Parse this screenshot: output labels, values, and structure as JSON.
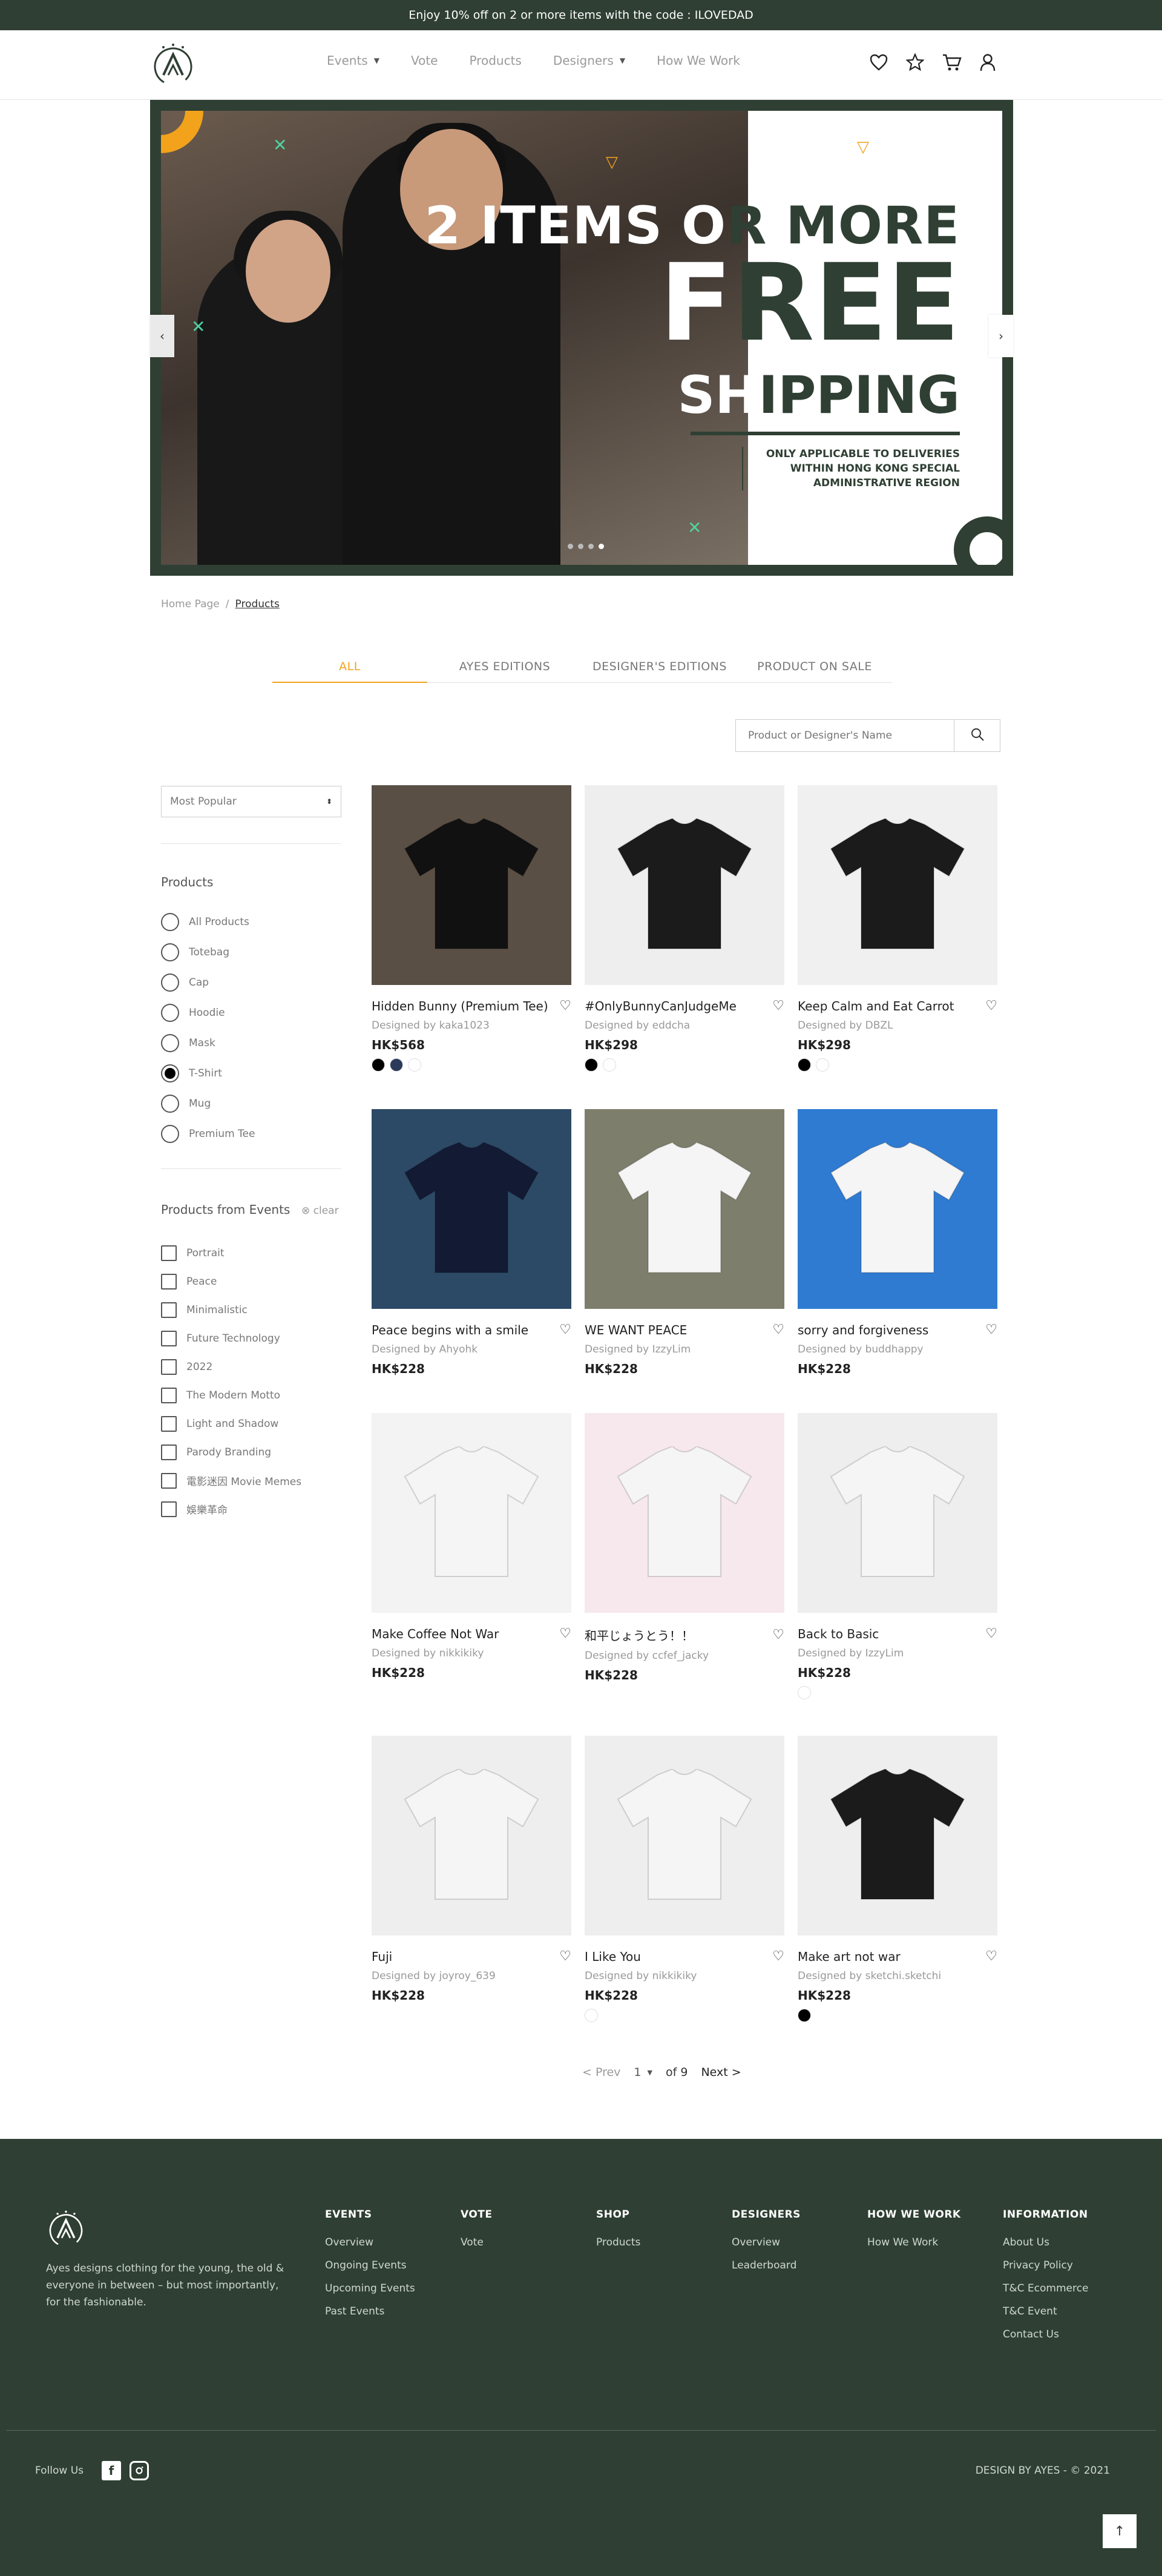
{
  "promo": {
    "text": "Enjoy 10% off on 2 or more items with the code : ILOVEDAD"
  },
  "nav": {
    "items": [
      {
        "label": "Events",
        "dropdown": true
      },
      {
        "label": "Vote",
        "dropdown": false
      },
      {
        "label": "Products",
        "dropdown": false
      },
      {
        "label": "Designers",
        "dropdown": true
      },
      {
        "label": "How We Work",
        "dropdown": false
      }
    ],
    "icons": [
      "heart-icon",
      "star-icon",
      "cart-icon",
      "user-icon"
    ]
  },
  "hero": {
    "line1": "2 ITEMS OR MORE",
    "line2": "FREE",
    "line3": "SHIPPING",
    "note": "ONLY APPLICABLE TO DELIVERIES WITHIN HONG KONG SPECIAL ADMINISTRATIVE REGION",
    "slides": 4,
    "active_slide": 4
  },
  "breadcrumb": {
    "home": "Home Page",
    "separator": "/",
    "current": "Products"
  },
  "tabs": [
    "ALL",
    "AYES EDITIONS",
    "DESIGNER'S EDITIONS",
    "PRODUCT ON SALE"
  ],
  "active_tab": "ALL",
  "search": {
    "placeholder": "Product or Designer's Name"
  },
  "sidebar": {
    "sort": "Most Popular",
    "products_title": "Products",
    "products": [
      "All Products",
      "Totebag",
      "Cap",
      "Hoodie",
      "Mask",
      "T-Shirt",
      "Mug",
      "Premium Tee"
    ],
    "selected_product": "T-Shirt",
    "events_title": "Products from Events",
    "clear_label": "⊗ clear",
    "events": [
      "Portrait",
      "Peace",
      "Minimalistic",
      "Future Technology",
      "2022",
      "The Modern Motto",
      "Light and Shadow",
      "Parody Branding",
      "電影迷因 Movie Memes",
      "娛樂革命"
    ]
  },
  "products": [
    {
      "name": "Hidden Bunny (Premium Tee)",
      "designer": "Designed by kaka1023",
      "price": "HK$568",
      "swatches": [
        "#000000",
        "#2b3a5a",
        "#ffffff"
      ],
      "shirt": "#111111"
    },
    {
      "name": "#OnlyBunnyCanJudgeMe",
      "designer": "Designed by eddcha",
      "price": "HK$298",
      "swatches": [
        "#000000",
        "#ffffff"
      ],
      "shirt": "#1b1b1b"
    },
    {
      "name": "Keep Calm and Eat Carrot",
      "designer": "Designed by DBZL",
      "price": "HK$298",
      "swatches": [
        "#000000",
        "#ffffff"
      ],
      "shirt": "#1b1b1b"
    },
    {
      "name": "Peace begins with a smile",
      "designer": "Designed by Ahyohk",
      "price": "HK$228",
      "swatches": [],
      "shirt": "#131a33"
    },
    {
      "name": "WE WANT PEACE",
      "designer": "Designed by IzzyLim",
      "price": "HK$228",
      "swatches": [],
      "shirt": "#f5f5f5"
    },
    {
      "name": "sorry and forgiveness",
      "designer": "Designed by buddhappy",
      "price": "HK$228",
      "swatches": [],
      "shirt": "#f5f5f5"
    },
    {
      "name": "Make Coffee Not War",
      "designer": "Designed by nikkikiky",
      "price": "HK$228",
      "swatches": [],
      "shirt": "#f5f5f5"
    },
    {
      "name": "和平じょうとう！！",
      "designer": "Designed by ccfef_jacky",
      "price": "HK$228",
      "swatches": [],
      "shirt": "#f5f5f5"
    },
    {
      "name": "Back to Basic",
      "designer": "Designed by IzzyLim",
      "price": "HK$228",
      "swatches": [
        "#ffffff"
      ],
      "shirt": "#f5f5f5"
    },
    {
      "name": "Fuji",
      "designer": "Designed by joyroy_639",
      "price": "HK$228",
      "swatches": [],
      "shirt": "#f5f5f5"
    },
    {
      "name": "I Like You",
      "designer": "Designed by nikkikiky",
      "price": "HK$228",
      "swatches": [
        "#ffffff"
      ],
      "shirt": "#f5f5f5"
    },
    {
      "name": "Make art not war",
      "designer": "Designed by sketchi.sketchi",
      "price": "HK$228",
      "swatches": [
        "#000000"
      ],
      "shirt": "#1b1b1b"
    }
  ],
  "pagination": {
    "prev": "<  Prev",
    "page": "1",
    "of": "of 9",
    "next": "Next  >"
  },
  "footer": {
    "about": "Ayes designs clothing for the young, the old & everyone in between – but most importantly, for the fashionable.",
    "columns": [
      {
        "title": "EVENTS",
        "links": [
          "Overview",
          "Ongoing Events",
          "Upcoming Events",
          "Past Events"
        ]
      },
      {
        "title": "VOTE",
        "links": [
          "Vote"
        ]
      },
      {
        "title": "SHOP",
        "links": [
          "Products"
        ]
      },
      {
        "title": "DESIGNERS",
        "links": [
          "Overview",
          "Leaderboard"
        ]
      },
      {
        "title": "HOW WE WORK",
        "links": [
          "How We Work"
        ]
      },
      {
        "title": "INFORMATION",
        "links": [
          "About Us",
          "Privacy Policy",
          "T&C Ecommerce",
          "T&C Event",
          "Contact Us"
        ]
      }
    ],
    "follow": "Follow Us",
    "copyright": "DESIGN BY AYES - © 2021"
  },
  "colors": {
    "brand": "#2f3f33",
    "accent": "#f2a31b",
    "mint": "#4fd3a0"
  }
}
